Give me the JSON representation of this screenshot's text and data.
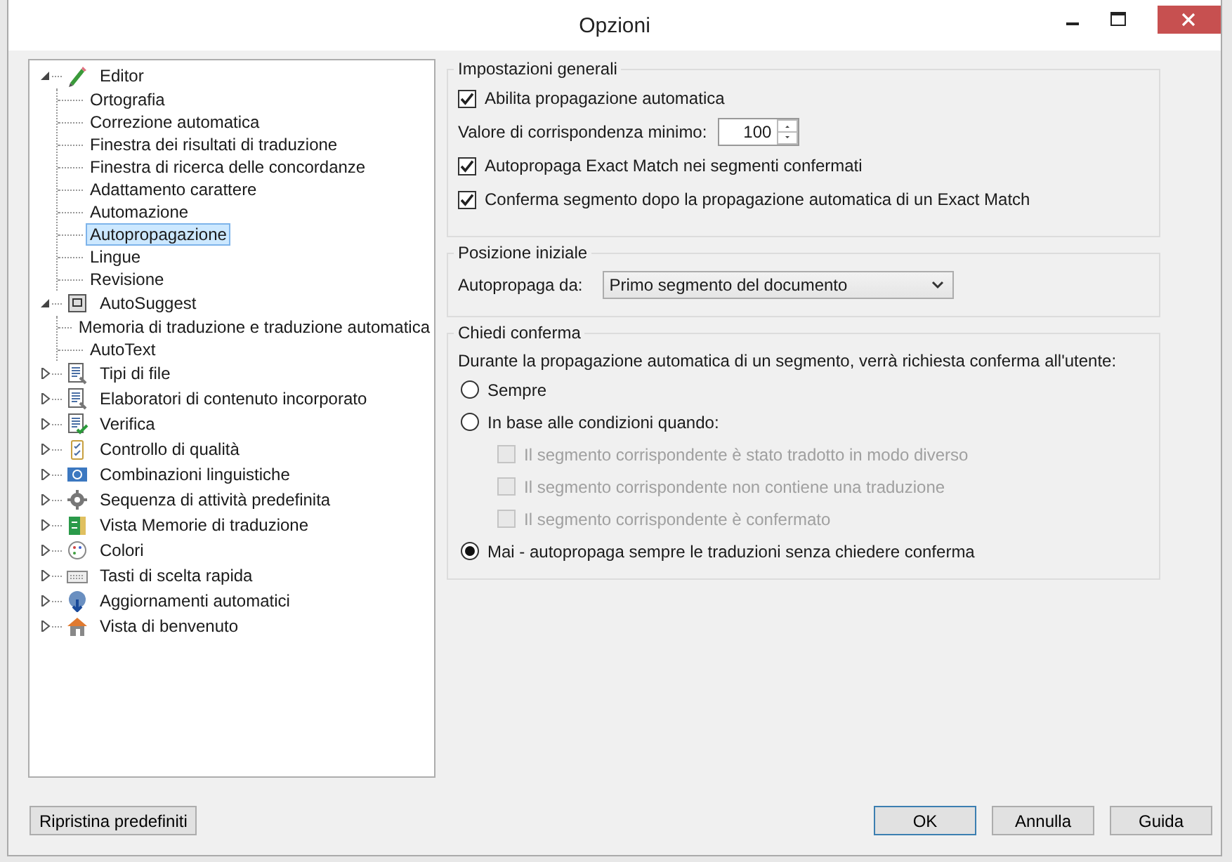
{
  "window": {
    "title": "Opzioni"
  },
  "tree": [
    {
      "label": "Editor",
      "expanded": true,
      "selected": false,
      "children": [
        {
          "label": "Ortografia",
          "selected": false
        },
        {
          "label": "Correzione automatica",
          "selected": false
        },
        {
          "label": "Finestra dei risultati di traduzione",
          "selected": false
        },
        {
          "label": "Finestra di ricerca delle concordanze",
          "selected": false
        },
        {
          "label": "Adattamento carattere",
          "selected": false
        },
        {
          "label": "Automazione",
          "selected": false
        },
        {
          "label": "Autopropagazione",
          "selected": true
        },
        {
          "label": "Lingue",
          "selected": false
        },
        {
          "label": "Revisione",
          "selected": false
        }
      ]
    },
    {
      "label": "AutoSuggest",
      "expanded": true,
      "selected": false,
      "children": [
        {
          "label": "Memoria di traduzione e traduzione automatica",
          "selected": false
        },
        {
          "label": "AutoText",
          "selected": false
        }
      ]
    },
    {
      "label": "Tipi di file",
      "expanded": false,
      "selected": false
    },
    {
      "label": "Elaboratori di contenuto incorporato",
      "expanded": false,
      "selected": false
    },
    {
      "label": "Verifica",
      "expanded": false,
      "selected": false
    },
    {
      "label": "Controllo di qualità",
      "expanded": false,
      "selected": false
    },
    {
      "label": "Combinazioni linguistiche",
      "expanded": false,
      "selected": false
    },
    {
      "label": "Sequenza di attività predefinita",
      "expanded": false,
      "selected": false
    },
    {
      "label": "Vista Memorie di traduzione",
      "expanded": false,
      "selected": false
    },
    {
      "label": "Colori",
      "expanded": false,
      "selected": false
    },
    {
      "label": "Tasti di scelta rapida",
      "expanded": false,
      "selected": false
    },
    {
      "label": "Aggiornamenti automatici",
      "expanded": false,
      "selected": false
    },
    {
      "label": "Vista di benvenuto",
      "expanded": false,
      "selected": false
    }
  ],
  "general": {
    "title": "Impostazioni generali",
    "options": [
      {
        "kind": "checkbox",
        "label": "Abilita propagazione automatica",
        "checked": true,
        "disabled": false
      },
      {
        "kind": "spinner",
        "label": "Valore di corrispondenza minimo:",
        "value": "100"
      },
      {
        "kind": "checkbox",
        "label": "Autopropaga Exact Match nei segmenti confermati",
        "checked": true,
        "disabled": false
      },
      {
        "kind": "checkbox",
        "label": "Conferma segmento dopo la propagazione automatica di un Exact Match",
        "checked": true,
        "disabled": false
      }
    ]
  },
  "start": {
    "title": "Posizione iniziale",
    "label": "Autopropaga da:",
    "value": "Primo segmento del documento"
  },
  "confirm": {
    "title": "Chiedi conferma",
    "description": "Durante la propagazione automatica di un segmento, verrà richiesta conferma all'utente:",
    "options": [
      {
        "kind": "radio",
        "label": "Sempre",
        "selected": false
      },
      {
        "kind": "radio",
        "label": "In base alle condizioni quando:",
        "selected": false
      },
      {
        "kind": "checkbox",
        "label": "Il segmento corrispondente è stato tradotto in modo diverso",
        "checked": false,
        "disabled": true
      },
      {
        "kind": "checkbox",
        "label": "Il segmento corrispondente non contiene una traduzione",
        "checked": false,
        "disabled": true
      },
      {
        "kind": "checkbox",
        "label": "Il segmento corrispondente è confermato",
        "checked": false,
        "disabled": true
      },
      {
        "kind": "radio",
        "label": "Mai - autopropaga sempre le traduzioni senza chiedere conferma",
        "selected": true
      }
    ]
  },
  "buttons": [
    {
      "label": "Ripristina predefiniti",
      "default": false
    },
    {
      "label": "OK",
      "default": true
    },
    {
      "label": "Annulla",
      "default": false
    },
    {
      "label": "Guida",
      "default": false
    }
  ]
}
